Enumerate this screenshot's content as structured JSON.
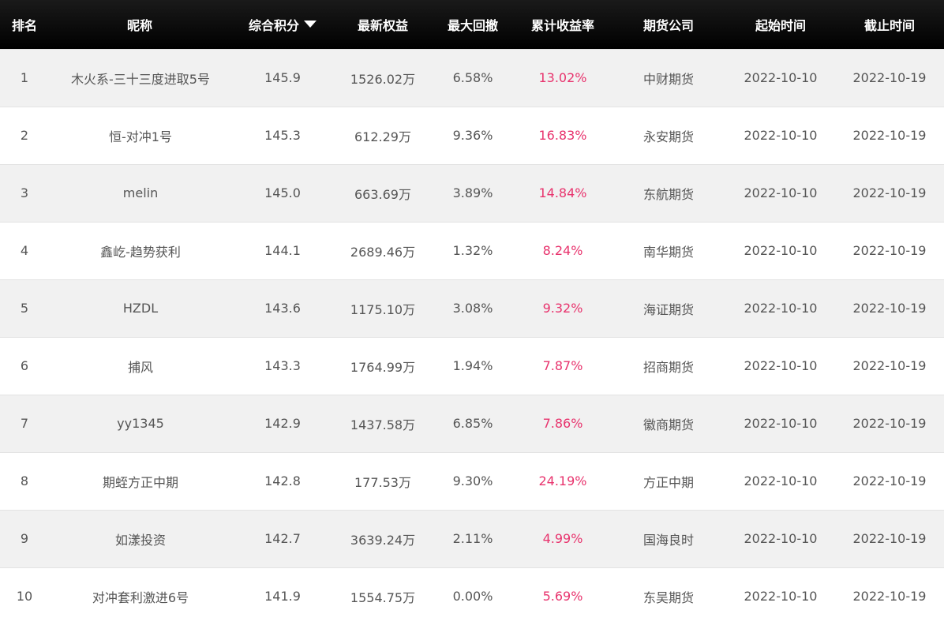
{
  "table": {
    "headers": {
      "rank": "排名",
      "nickname": "昵称",
      "score": "综合积分",
      "equity": "最新权益",
      "drawdown": "最大回撤",
      "return": "累计收益率",
      "company": "期货公司",
      "start": "起始时间",
      "end": "截止时间"
    },
    "sort_icon": "caret-down-icon",
    "accent_color": "#e8336d",
    "rows": [
      {
        "rank": "1",
        "nickname": "木火系-三十三度进取5号",
        "score": "145.9",
        "equity": "1526.02万",
        "drawdown": "6.58%",
        "return": "13.02%",
        "company": "中财期货",
        "start": "2022-10-10",
        "end": "2022-10-19"
      },
      {
        "rank": "2",
        "nickname": "恒-对冲1号",
        "score": "145.3",
        "equity": "612.29万",
        "drawdown": "9.36%",
        "return": "16.83%",
        "company": "永安期货",
        "start": "2022-10-10",
        "end": "2022-10-19"
      },
      {
        "rank": "3",
        "nickname": "melin",
        "score": "145.0",
        "equity": "663.69万",
        "drawdown": "3.89%",
        "return": "14.84%",
        "company": "东航期货",
        "start": "2022-10-10",
        "end": "2022-10-19"
      },
      {
        "rank": "4",
        "nickname": "鑫屹-趋势获利",
        "score": "144.1",
        "equity": "2689.46万",
        "drawdown": "1.32%",
        "return": "8.24%",
        "company": "南华期货",
        "start": "2022-10-10",
        "end": "2022-10-19"
      },
      {
        "rank": "5",
        "nickname": "HZDL",
        "score": "143.6",
        "equity": "1175.10万",
        "drawdown": "3.08%",
        "return": "9.32%",
        "company": "海证期货",
        "start": "2022-10-10",
        "end": "2022-10-19"
      },
      {
        "rank": "6",
        "nickname": "捕风",
        "score": "143.3",
        "equity": "1764.99万",
        "drawdown": "1.94%",
        "return": "7.87%",
        "company": "招商期货",
        "start": "2022-10-10",
        "end": "2022-10-19"
      },
      {
        "rank": "7",
        "nickname": "yy1345",
        "score": "142.9",
        "equity": "1437.58万",
        "drawdown": "6.85%",
        "return": "7.86%",
        "company": "徽商期货",
        "start": "2022-10-10",
        "end": "2022-10-19"
      },
      {
        "rank": "8",
        "nickname": "期蛭方正中期",
        "score": "142.8",
        "equity": "177.53万",
        "drawdown": "9.30%",
        "return": "24.19%",
        "company": "方正中期",
        "start": "2022-10-10",
        "end": "2022-10-19"
      },
      {
        "rank": "9",
        "nickname": "如漾投资",
        "score": "142.7",
        "equity": "3639.24万",
        "drawdown": "2.11%",
        "return": "4.99%",
        "company": "国海良时",
        "start": "2022-10-10",
        "end": "2022-10-19"
      },
      {
        "rank": "10",
        "nickname": "对冲套利激进6号",
        "score": "141.9",
        "equity": "1554.75万",
        "drawdown": "0.00%",
        "return": "5.69%",
        "company": "东吴期货",
        "start": "2022-10-10",
        "end": "2022-10-19"
      }
    ]
  }
}
